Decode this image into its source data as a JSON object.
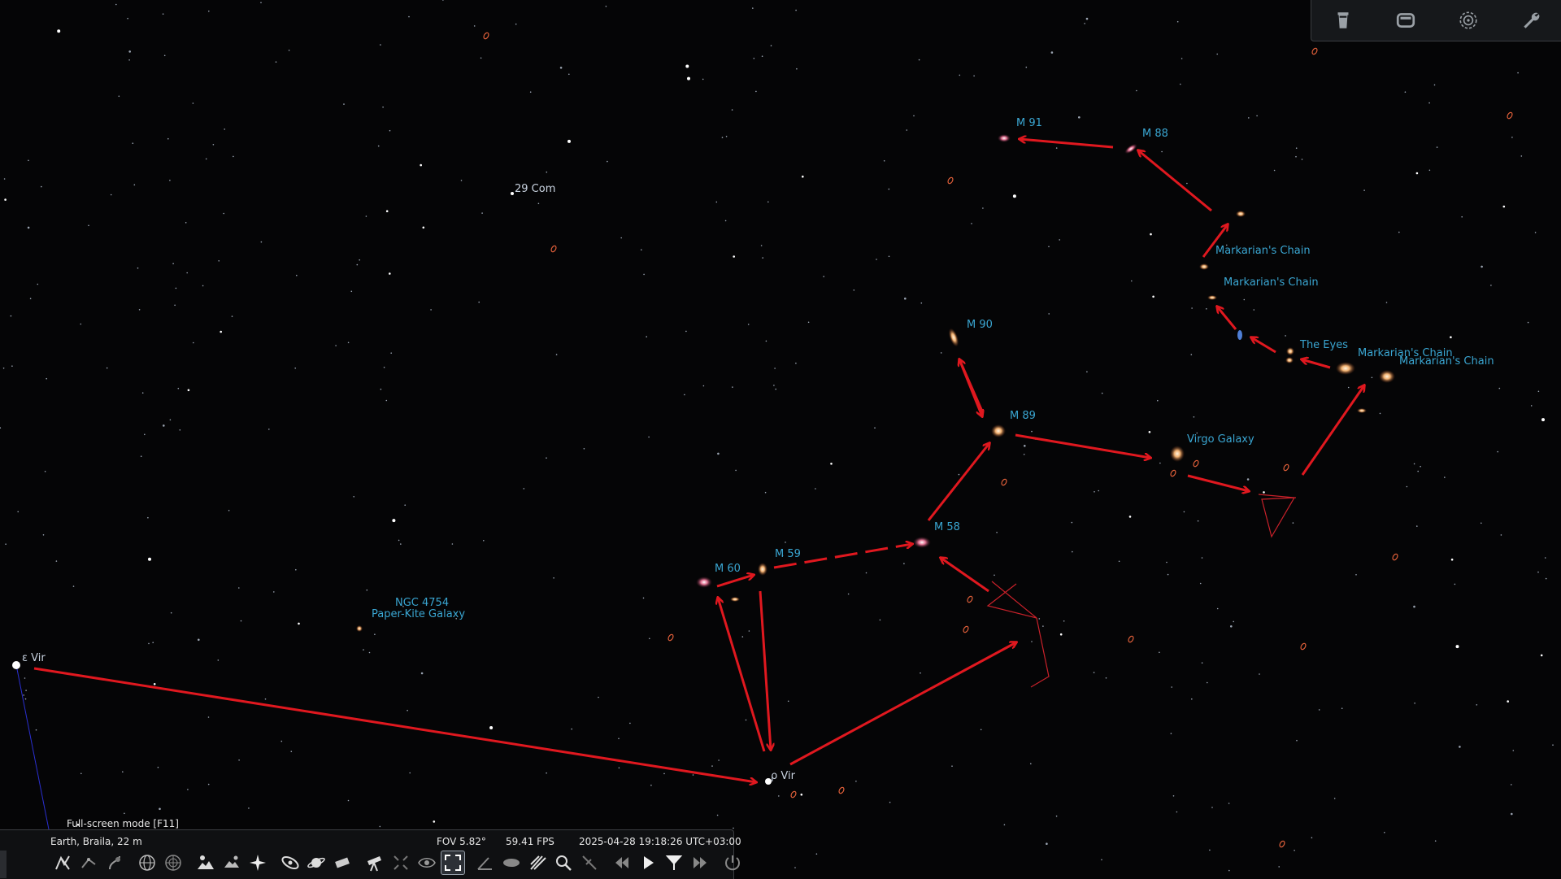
{
  "sky_labels": {
    "m91": "M 91",
    "m88": "M 88",
    "com29": "29 Com",
    "markarian1": "Markarian's Chain",
    "markarian2": "Markarian's Chain",
    "markarian3": "Markarian's Chain",
    "markarian4": "Markarian's Chain",
    "the_eyes": "The Eyes",
    "m90": "M 90",
    "m89": "M 89",
    "virgo_galaxy": "Virgo Galaxy",
    "m58": "M 58",
    "m59": "M 59",
    "m60": "M 60",
    "ngc4754": "NGC 4754",
    "paper_kite": "Paper-Kite Galaxy",
    "eps_vir": "ε Vir",
    "rho_vir": "ρ Vir"
  },
  "colors": {
    "sky_background": "#050506",
    "dso_label": "#3aa6d2",
    "star_label": "#c9d3e0",
    "arrow": "#e0181f",
    "constellation_line": "#c9212a",
    "boundary_line": "#2a2fd0"
  },
  "top_toolbar": {
    "buttons": [
      {
        "name": "trash-icon"
      },
      {
        "name": "window-icon"
      },
      {
        "name": "target-icon"
      },
      {
        "name": "wrench-icon"
      }
    ]
  },
  "bottom_bar": {
    "fullscreen_hint": "Full-screen mode  [F11]",
    "location": "Earth, Braila, 22 m",
    "fov": "FOV 5.82°",
    "fps": "59.41 FPS",
    "datetime": "2025-04-28 19:18:26 UTC+03:00"
  }
}
